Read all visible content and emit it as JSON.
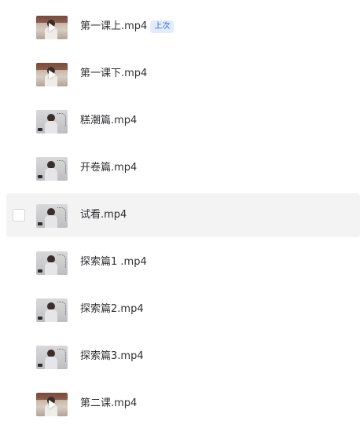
{
  "files": [
    {
      "name": "第一课上.mp4",
      "badge": "上次",
      "thumb": "classroom",
      "play": true,
      "hovered": false
    },
    {
      "name": "第一课下.mp4",
      "badge": null,
      "thumb": "classroom",
      "play": true,
      "hovered": false
    },
    {
      "name": "糕潮篇.mp4",
      "badge": null,
      "thumb": "studio",
      "play": false,
      "hovered": false
    },
    {
      "name": "开卷篇.mp4",
      "badge": null,
      "thumb": "studio",
      "play": false,
      "hovered": false
    },
    {
      "name": "试看.mp4",
      "badge": null,
      "thumb": "studio",
      "play": false,
      "hovered": true
    },
    {
      "name": "探索篇1 .mp4",
      "badge": null,
      "thumb": "studio",
      "play": false,
      "hovered": false
    },
    {
      "name": "探索篇2.mp4",
      "badge": null,
      "thumb": "studio",
      "play": false,
      "hovered": false
    },
    {
      "name": "探索篇3.mp4",
      "badge": null,
      "thumb": "studio",
      "play": false,
      "hovered": false
    },
    {
      "name": "第二课.mp4",
      "badge": null,
      "thumb": "classroom",
      "play": true,
      "hovered": false
    }
  ],
  "colors": {
    "badge_text": "#2f6fe0",
    "badge_bg": "#e3ecfd",
    "hover_row_bg": "#f3f3f4",
    "text": "#2f3033"
  }
}
